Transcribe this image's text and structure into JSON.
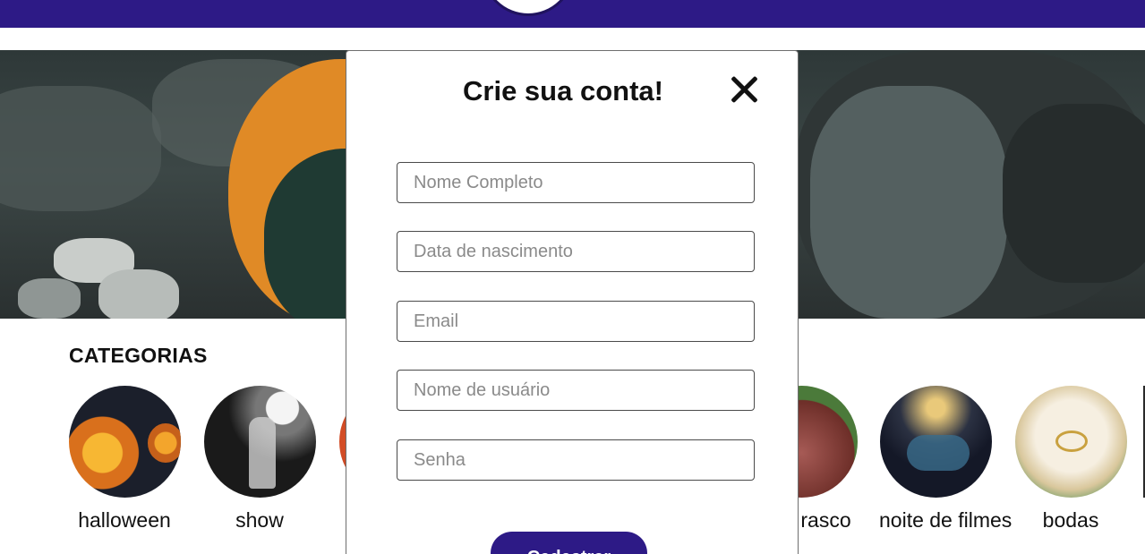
{
  "colors": {
    "brand": "#2d1a86",
    "text": "#111111",
    "border": "#4a4a4a"
  },
  "categories": {
    "title": "CATEGORIAS",
    "items": [
      {
        "label": "halloween"
      },
      {
        "label": "show"
      },
      {
        "label": ""
      },
      {
        "label": "rasco"
      },
      {
        "label": "noite de filmes"
      },
      {
        "label": "bodas"
      }
    ]
  },
  "modal": {
    "title": "Crie sua conta!",
    "close_icon": "close-icon",
    "fields": [
      {
        "placeholder": "Nome Completo"
      },
      {
        "placeholder": "Data de nascimento"
      },
      {
        "placeholder": "Email"
      },
      {
        "placeholder": "Nome de usuário"
      },
      {
        "placeholder": "Senha"
      }
    ],
    "submit_label": "Cadastrar"
  }
}
